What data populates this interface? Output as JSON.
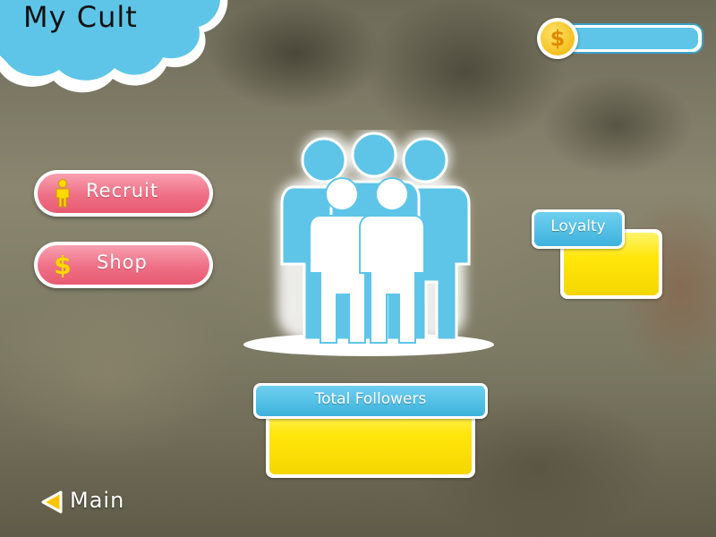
{
  "header": {
    "title": "My Cult"
  },
  "currency": {
    "icon": "dollar-coin-icon",
    "symbol": "$",
    "value": ""
  },
  "menu": {
    "recruit": {
      "label": "Recruit",
      "icon": "person-icon"
    },
    "shop": {
      "label": "Shop",
      "icon": "dollar-icon",
      "symbol": "$"
    }
  },
  "stats": {
    "loyalty": {
      "label": "Loyalty",
      "value": ""
    },
    "total_followers": {
      "label": "Total Followers",
      "value": ""
    }
  },
  "nav": {
    "back_label": "Main",
    "back_icon": "back-arrow-icon"
  },
  "colors": {
    "cloud": "#5ec5e8",
    "button_pink": "#ef6f85",
    "tab_blue": "#3db2dc",
    "value_yellow": "#ffe60a",
    "figure_blue": "#5ec5e8",
    "accent_gold": "#ffd800"
  }
}
